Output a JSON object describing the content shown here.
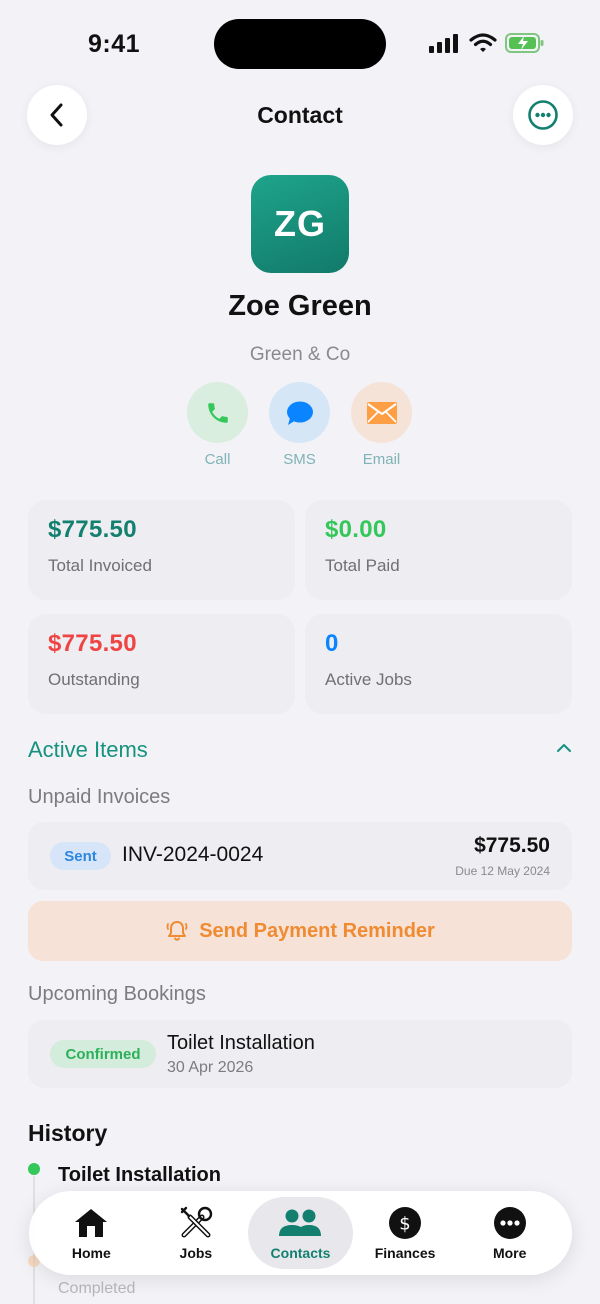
{
  "status_bar": {
    "time": "9:41"
  },
  "header": {
    "title": "Contact"
  },
  "contact": {
    "initials": "ZG",
    "name": "Zoe Green",
    "company": "Green & Co"
  },
  "actions": [
    {
      "label": "Call",
      "icon": "phone-icon",
      "color": "#34c759",
      "bg": "#d9eedf"
    },
    {
      "label": "SMS",
      "icon": "message-bubble-icon",
      "color": "#0a84ff",
      "bg": "#d5e6f7"
    },
    {
      "label": "Email",
      "icon": "envelope-icon",
      "color": "#ff9f45",
      "bg": "#f6e3d8"
    }
  ],
  "stats": [
    {
      "value": "$775.50",
      "label": "Total Invoiced",
      "color": "#13806f"
    },
    {
      "value": "$0.00",
      "label": "Total Paid",
      "color": "#34c759"
    },
    {
      "value": "$775.50",
      "label": "Outstanding",
      "color": "#ef4444"
    },
    {
      "value": "0",
      "label": "Active Jobs",
      "color": "#0a84ff"
    }
  ],
  "active_items": {
    "title": "Active Items",
    "unpaid_title": "Unpaid Invoices",
    "invoice": {
      "status": "Sent",
      "number": "INV-2024-0024",
      "amount": "$775.50",
      "due": "Due 12 May 2024"
    },
    "reminder_label": "Send Payment Reminder",
    "bookings_title": "Upcoming Bookings",
    "booking": {
      "status": "Confirmed",
      "title": "Toilet Installation",
      "date": "30 Apr 2026"
    }
  },
  "history": {
    "title": "History",
    "items": [
      {
        "title": "Toilet Installation"
      },
      {
        "status": "Completed"
      }
    ]
  },
  "tab_bar": [
    {
      "label": "Home",
      "icon": "home-icon"
    },
    {
      "label": "Jobs",
      "icon": "tools-icon"
    },
    {
      "label": "Contacts",
      "icon": "people-icon",
      "active": true
    },
    {
      "label": "Finances",
      "icon": "dollar-icon"
    },
    {
      "label": "More",
      "icon": "more-dots-icon"
    }
  ],
  "colors": {
    "accent": "#13806f",
    "background": "#f2f2f7"
  }
}
